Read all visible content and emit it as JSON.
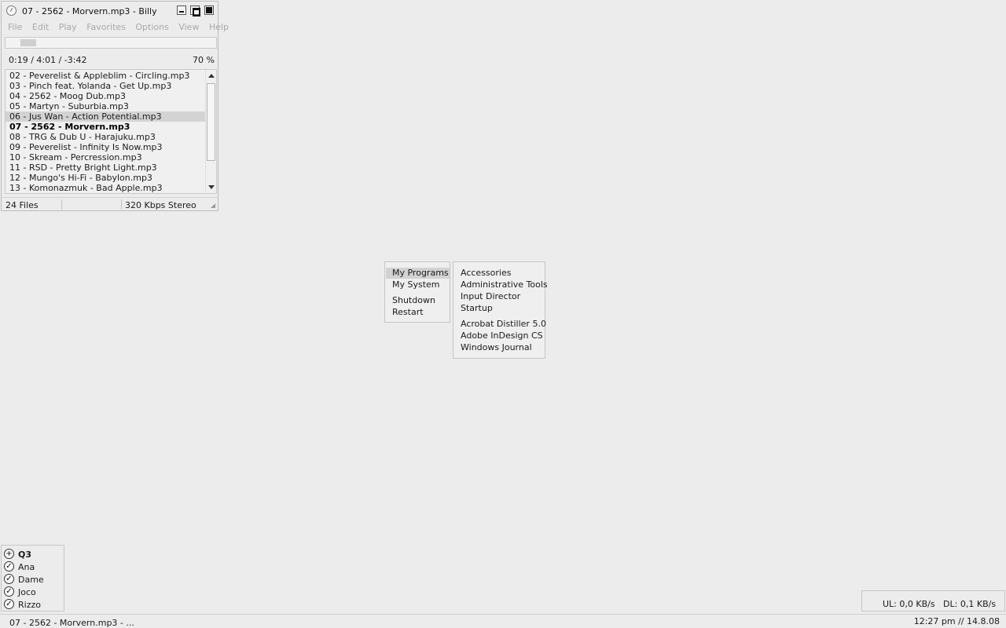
{
  "player": {
    "title": "07 - 2562 - Morvern.mp3 - Billy",
    "menu": [
      "File",
      "Edit",
      "Play",
      "Favorites",
      "Options",
      "View",
      "Help"
    ],
    "time": "0:19 / 4:01 / -3:42",
    "volume": "70 %",
    "progress_fraction": 0.079,
    "playlist": [
      "02 - Peverelist & Appleblim - Circling.mp3",
      "03 - Pinch feat. Yolanda - Get Up.mp3",
      "04 - 2562 - Moog Dub.mp3",
      "05 - Martyn - Suburbia.mp3",
      "06 - Jus Wan - Action Potential.mp3",
      "07 - 2562 - Morvern.mp3",
      "08 - TRG & Dub U - Harajuku.mp3",
      "09 - Peverelist - Infinity Is Now.mp3",
      "10 - Skream - Percression.mp3",
      "11 - RSD - Pretty Bright Light.mp3",
      "12 - Mungo's Hi-Fi - Babylon.mp3",
      "13 - Komonazmuk - Bad Apple.mp3"
    ],
    "selected_item": "06 - Jus Wan - Action Potential.mp3",
    "playing_item": "07 - 2562 - Morvern.mp3",
    "status": {
      "files": "24 Files",
      "bitrate": "320 Kbps Stereo"
    }
  },
  "launcher": {
    "left": {
      "items": [
        "My Programs",
        "My System",
        "Shutdown",
        "Restart"
      ],
      "active": "My Programs"
    },
    "right": {
      "items": [
        "Accessories",
        "Administrative Tools",
        "Input Director",
        "Startup",
        "Acrobat Distiller 5.0",
        "Adobe InDesign CS",
        "Windows Journal"
      ]
    }
  },
  "buddies": {
    "group": "Q3",
    "members": [
      "Ana",
      "Dame",
      "Joco",
      "Rizzo"
    ]
  },
  "transfer": {
    "text": "UL: 0,0 KB/s   DL: 0,1 KB/s"
  },
  "taskbar": {
    "title": "07 - 2562 - Morvern.mp3 - ...",
    "clock": "12:27 pm // 14.8.08"
  }
}
